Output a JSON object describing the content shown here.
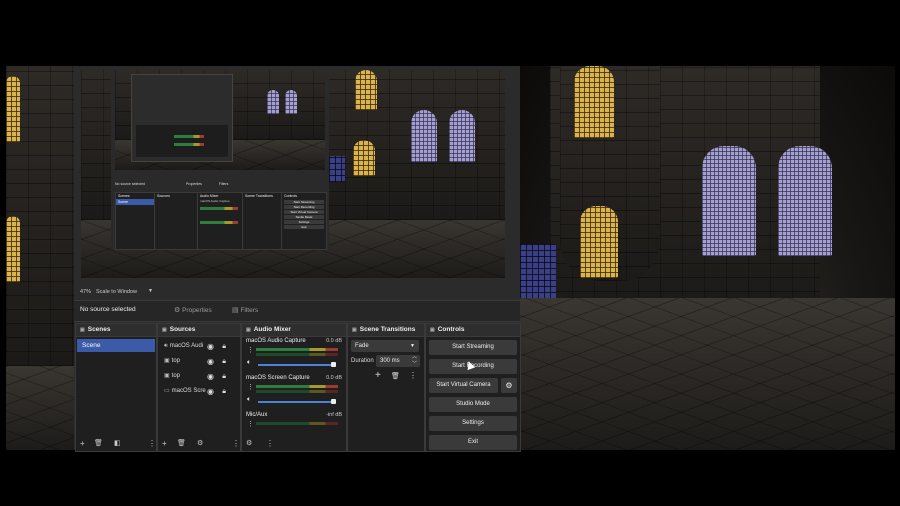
{
  "preview_toolbar": {
    "zoom": "47%",
    "scale_mode": "Scale to Window"
  },
  "context_bar": {
    "no_source": "No source selected",
    "properties": "Properties",
    "filters": "Filters"
  },
  "scenes": {
    "title": "Scenes",
    "items": [
      "Scene"
    ]
  },
  "sources": {
    "title": "Sources",
    "items": [
      {
        "icon": "audio",
        "name": "macOS Audi"
      },
      {
        "icon": "image",
        "name": "top"
      },
      {
        "icon": "image",
        "name": "top"
      },
      {
        "icon": "screen",
        "name": "macOS Scre"
      }
    ]
  },
  "mixer": {
    "title": "Audio Mixer",
    "channels": [
      {
        "name": "macOS Audio Capture",
        "db": "0.0 dB"
      },
      {
        "name": "macOS Screen Capture",
        "db": "0.0 dB"
      },
      {
        "name": "Mic/Aux",
        "db": "-inf dB"
      }
    ]
  },
  "transitions": {
    "title": "Scene Transitions",
    "selected": "Fade",
    "duration_label": "Duration",
    "duration": "300 ms"
  },
  "controls": {
    "title": "Controls",
    "buttons": {
      "stream": "Start Streaming",
      "record": "Start Recording",
      "virtual_cam": "Start Virtual Camera",
      "studio": "Studio Mode",
      "settings": "Settings",
      "exit": "Exit"
    }
  },
  "nested": {
    "context_no_source": "No source selected",
    "properties": "Properties",
    "filters": "Filters",
    "scenes": "Scenes",
    "scene_item": "Scene",
    "sources": "Sources",
    "mixer": "Audio Mixer",
    "mixer_ch1": "macOS Audio Capture",
    "transitions": "Scene Transitions",
    "controls": "Controls",
    "ctrl": [
      "Start Streaming",
      "Start Recording",
      "Start Virtual Camera",
      "Studio Mode",
      "Settings",
      "Exit"
    ]
  }
}
